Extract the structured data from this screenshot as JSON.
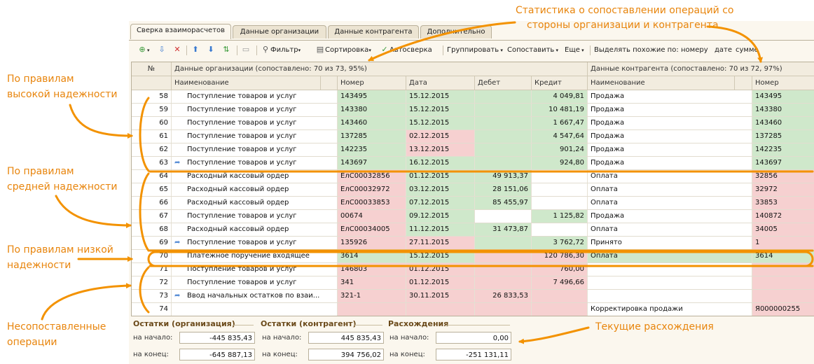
{
  "tabs": [
    "Сверка взаиморасчетов",
    "Данные организации",
    "Данные контрагента",
    "Дополнительно"
  ],
  "toolbar": {
    "filter": "Фильтр",
    "sort": "Сортировка",
    "auto": "Автосверка",
    "group": "Группировать",
    "compare": "Сопоставить",
    "more": "Еще",
    "similar": "Выделять похожие по:",
    "by_number": "номеру",
    "by_date": "дате",
    "by_sum": "сумме"
  },
  "grid": {
    "col_n": "№",
    "org_header": "Данные организации (сопоставлено: 70 из 73, 95%)",
    "cp_header": "Данные контрагента (сопоставлено: 70 из 72, 97%)",
    "cols": {
      "name": "Наименование",
      "number": "Номер",
      "date": "Дата",
      "debit": "Дебет",
      "credit": "Кредит",
      "cp_name": "Наименование",
      "cp_number": "Номер"
    },
    "rows": [
      {
        "n": "58",
        "arrow": false,
        "name": "Поступление товаров и услуг",
        "num": "143495",
        "date": "15.12.2015",
        "debit": "",
        "credit": "4 049,81",
        "cpname": "Продажа",
        "cpnum": "143495",
        "cNum": "g",
        "cDate": "g",
        "cDeb": "g",
        "cCred": "g",
        "cCpName": "w",
        "cCpNum": "g"
      },
      {
        "n": "59",
        "arrow": false,
        "name": "Поступление товаров и услуг",
        "num": "143380",
        "date": "15.12.2015",
        "debit": "",
        "credit": "10 481,19",
        "cpname": "Продажа",
        "cpnum": "143380",
        "cNum": "g",
        "cDate": "g",
        "cDeb": "g",
        "cCred": "g",
        "cCpName": "w",
        "cCpNum": "g"
      },
      {
        "n": "60",
        "arrow": false,
        "name": "Поступление товаров и услуг",
        "num": "143460",
        "date": "15.12.2015",
        "debit": "",
        "credit": "1 667,47",
        "cpname": "Продажа",
        "cpnum": "143460",
        "cNum": "g",
        "cDate": "g",
        "cDeb": "g",
        "cCred": "g",
        "cCpName": "w",
        "cCpNum": "g"
      },
      {
        "n": "61",
        "arrow": false,
        "name": "Поступление товаров и услуг",
        "num": "137285",
        "date": "02.12.2015",
        "debit": "",
        "credit": "4 547,64",
        "cpname": "Продажа",
        "cpnum": "137285",
        "cNum": "g",
        "cDate": "p",
        "cDeb": "g",
        "cCred": "g",
        "cCpName": "w",
        "cCpNum": "g"
      },
      {
        "n": "62",
        "arrow": false,
        "name": "Поступление товаров и услуг",
        "num": "142235",
        "date": "13.12.2015",
        "debit": "",
        "credit": "901,24",
        "cpname": "Продажа",
        "cpnum": "142235",
        "cNum": "g",
        "cDate": "p",
        "cDeb": "g",
        "cCred": "g",
        "cCpName": "w",
        "cCpNum": "g"
      },
      {
        "n": "63",
        "arrow": true,
        "name": "Поступление товаров и услуг",
        "num": "143697",
        "date": "16.12.2015",
        "debit": "",
        "credit": "924,80",
        "cpname": "Продажа",
        "cpnum": "143697",
        "cNum": "g",
        "cDate": "g",
        "cDeb": "g",
        "cCred": "g",
        "cCpName": "w",
        "cCpNum": "g"
      },
      {
        "n": "64",
        "arrow": false,
        "name": "Расходный кассовый ордер",
        "num": "ЕлС00032856",
        "date": "01.12.2015",
        "debit": "49 913,37",
        "credit": "",
        "cpname": "Оплата",
        "cpnum": "32856",
        "cNum": "p",
        "cDate": "g",
        "cDeb": "g",
        "cCred": "w",
        "cCpName": "w",
        "cCpNum": "p"
      },
      {
        "n": "65",
        "arrow": false,
        "name": "Расходный кассовый ордер",
        "num": "ЕлС00032972",
        "date": "03.12.2015",
        "debit": "28 151,06",
        "credit": "",
        "cpname": "Оплата",
        "cpnum": "32972",
        "cNum": "p",
        "cDate": "g",
        "cDeb": "g",
        "cCred": "w",
        "cCpName": "w",
        "cCpNum": "p"
      },
      {
        "n": "66",
        "arrow": false,
        "name": "Расходный кассовый ордер",
        "num": "ЕлС00033853",
        "date": "07.12.2015",
        "debit": "85 455,97",
        "credit": "",
        "cpname": "Оплата",
        "cpnum": "33853",
        "cNum": "p",
        "cDate": "g",
        "cDeb": "g",
        "cCred": "w",
        "cCpName": "w",
        "cCpNum": "p"
      },
      {
        "n": "67",
        "arrow": false,
        "name": "Поступление товаров и услуг",
        "num": "00674",
        "date": "09.12.2015",
        "debit": "",
        "credit": "1 125,82",
        "cpname": "Продажа",
        "cpnum": "140872",
        "cNum": "p",
        "cDate": "g",
        "cDeb": "w",
        "cCred": "g",
        "cCpName": "w",
        "cCpNum": "p"
      },
      {
        "n": "68",
        "arrow": false,
        "name": "Расходный кассовый ордер",
        "num": "ЕлС00034005",
        "date": "11.12.2015",
        "debit": "31 473,87",
        "credit": "",
        "cpname": "Оплата",
        "cpnum": "34005",
        "cNum": "p",
        "cDate": "g",
        "cDeb": "g",
        "cCred": "w",
        "cCpName": "w",
        "cCpNum": "p"
      },
      {
        "n": "69",
        "arrow": true,
        "name": "Поступление товаров и услуг",
        "num": "135926",
        "date": "27.11.2015",
        "debit": "",
        "credit": "3 762,72",
        "cpname": "Принято",
        "cpnum": "1",
        "cNum": "p",
        "cDate": "p",
        "cDeb": "g",
        "cCred": "g",
        "cCpName": "w",
        "cCpNum": "p"
      },
      {
        "n": "70",
        "arrow": false,
        "name": "Платежное поручение входящее",
        "num": "3614",
        "date": "15.12.2015",
        "debit": "",
        "credit": "120 786,30",
        "cpname": "Оплата",
        "cpnum": "3614",
        "cNum": "g",
        "cDate": "g",
        "cDeb": "p",
        "cCred": "p",
        "cCpName": "g",
        "cCpNum": "g"
      },
      {
        "n": "71",
        "arrow": false,
        "name": "Поступление товаров и услуг",
        "num": "146803",
        "date": "01.12.2015",
        "debit": "",
        "credit": "760,00",
        "cpname": "",
        "cpnum": "",
        "cNum": "p",
        "cDate": "p",
        "cDeb": "p",
        "cCred": "p",
        "cCpName": "w",
        "cCpNum": "p"
      },
      {
        "n": "72",
        "arrow": false,
        "name": "Поступление товаров и услуг",
        "num": "341",
        "date": "01.12.2015",
        "debit": "",
        "credit": "7 496,66",
        "cpname": "",
        "cpnum": "",
        "cNum": "p",
        "cDate": "p",
        "cDeb": "p",
        "cCred": "p",
        "cCpName": "w",
        "cCpNum": "p"
      },
      {
        "n": "73",
        "arrow": true,
        "name": "Ввод начальных остатков по взаи...",
        "num": "321-1",
        "date": "30.11.2015",
        "debit": "26 833,53",
        "credit": "",
        "cpname": "",
        "cpnum": "",
        "cNum": "p",
        "cDate": "p",
        "cDeb": "p",
        "cCred": "p",
        "cCpName": "w",
        "cCpNum": "p"
      },
      {
        "n": "74",
        "arrow": false,
        "name": "",
        "num": "",
        "date": "",
        "debit": "",
        "credit": "",
        "cpname": "Корректировка продажи",
        "cpnum": "Я000000255",
        "cNum": "p",
        "cDate": "p",
        "cDeb": "p",
        "cCred": "p",
        "cCpName": "w",
        "cCpNum": "p"
      }
    ]
  },
  "totals": {
    "org_title": "Остатки (организация)",
    "cp_title": "Остатки (контрагент)",
    "diff_title": "Расхождения",
    "start_label": "на начало:",
    "end_label": "на конец:",
    "org_start": "-445 835,43",
    "org_end": "-645 887,13",
    "cp_start": "445 835,43",
    "cp_end": "394 756,02",
    "diff_start": "0,00",
    "diff_end": "-251 131,11"
  },
  "annotations": {
    "stats_1": "Статистика о сопоставлении операций со",
    "stats_2": "стороны организации и контрагента",
    "high_1": "По правилам",
    "high_2": "высокой надежности",
    "mid_1": "По правилам",
    "mid_2": "средней надежности",
    "low_1": "По правилам низкой",
    "low_2": "надежности",
    "unmatched_1": "Несопоставленные",
    "unmatched_2": "операции",
    "current_diff": "Текущие расхождения"
  },
  "colors": {
    "accent": "#f39200",
    "matched": "#cfe8cb",
    "mismatch": "#f6d0d0",
    "annotation_text": "#e8850d"
  }
}
